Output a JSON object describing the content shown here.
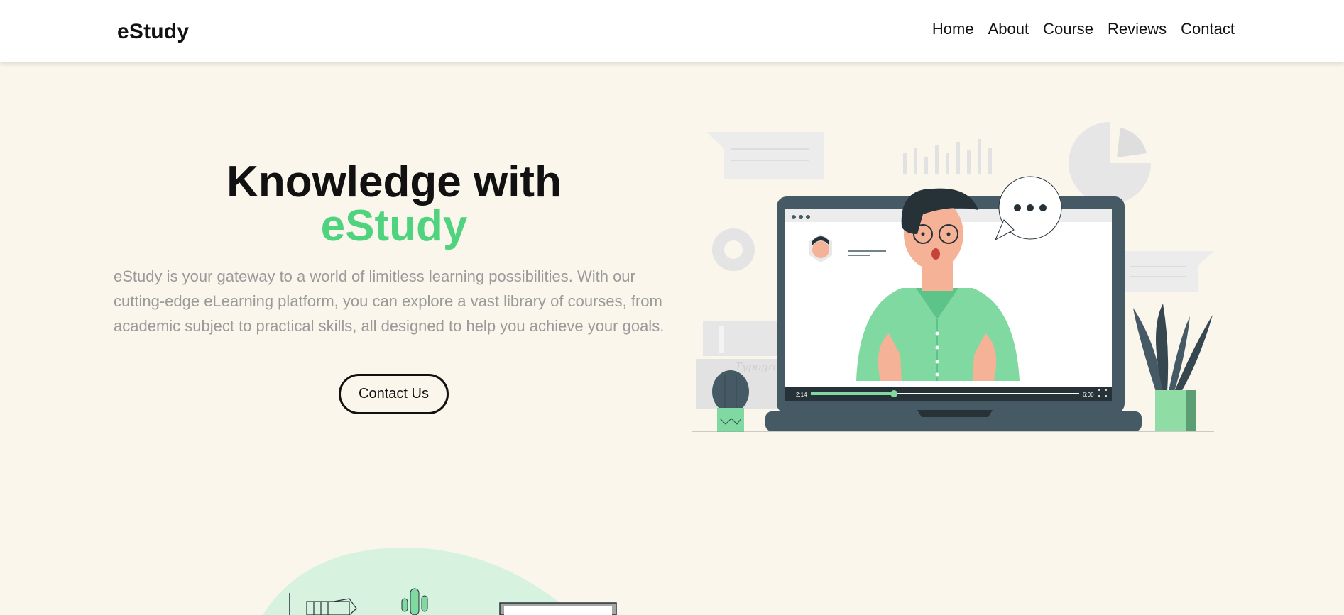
{
  "navbar": {
    "brand": "eStudy",
    "links": [
      "Home",
      "About",
      "Course",
      "Reviews",
      "Contact"
    ]
  },
  "hero": {
    "title_line1": "Knowledge with",
    "title_accent": "eStudy",
    "description": "eStudy is your gateway to a world of limitless learning possibilities. With our cutting-edge eLearning platform, you can explore a vast library of courses, from academic subject to practical skills, all designed to help you achieve your goals.",
    "cta_label": "Contact Us"
  },
  "illustration": {
    "video_time_current": "2:14",
    "video_time_total": "6:00",
    "video_progress": 0.31,
    "book_text": "Typogra"
  },
  "colors": {
    "accent": "#4fd37f",
    "background": "#faf6ec",
    "laptop": "#455a64"
  }
}
